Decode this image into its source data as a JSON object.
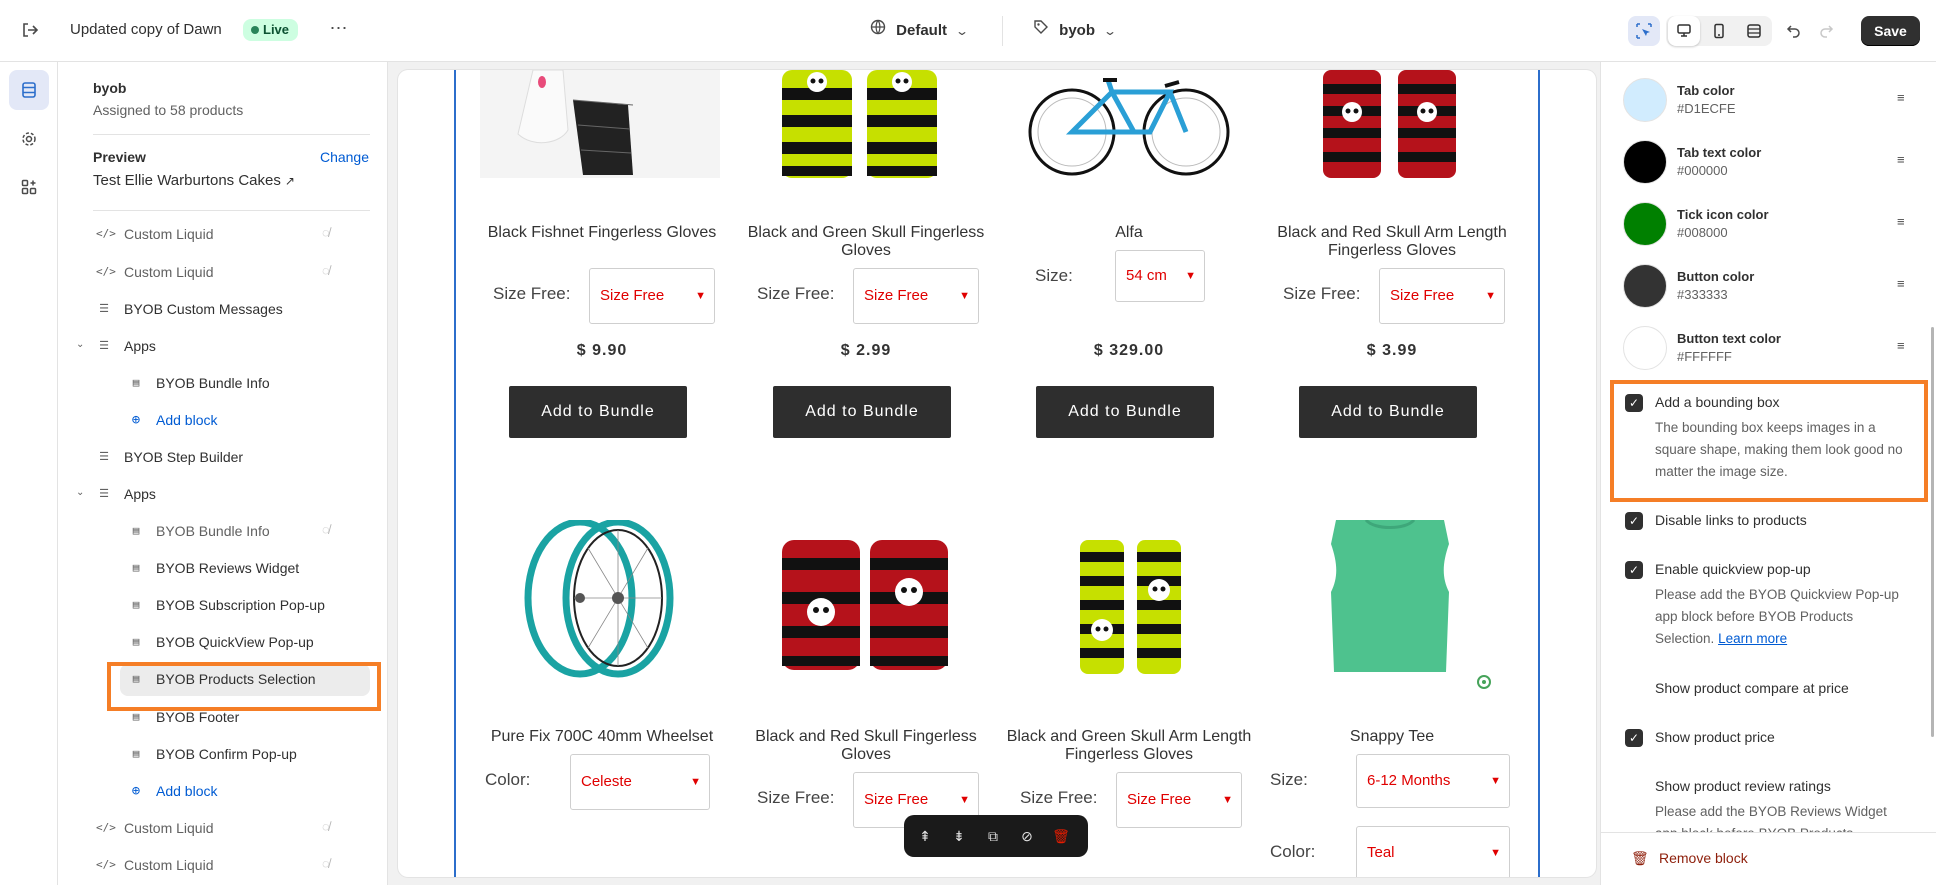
{
  "topbar": {
    "title": "Updated copy of Dawn",
    "status": "Live",
    "more": "⋯",
    "template_select": "Default",
    "page_select": "byob",
    "save_label": "Save"
  },
  "sidebar": {
    "heading": "byob",
    "subheading": "Assigned to 58 products",
    "preview_label": "Preview",
    "change_label": "Change",
    "preview_value": "Test Ellie Warburtons Cakes",
    "items": [
      {
        "label": "Custom Liquid"
      },
      {
        "label": "Custom Liquid"
      },
      {
        "label": "BYOB Custom Messages"
      },
      {
        "label": "Apps"
      },
      {
        "label": "BYOB Bundle Info"
      },
      {
        "label": "Add block"
      },
      {
        "label": "BYOB Step Builder"
      },
      {
        "label": "Apps"
      },
      {
        "label": "BYOB Bundle Info"
      },
      {
        "label": "BYOB Reviews Widget"
      },
      {
        "label": "BYOB Subscription Pop-up"
      },
      {
        "label": "BYOB QuickView Pop-up"
      },
      {
        "label": "BYOB Products Selection"
      },
      {
        "label": "BYOB Footer"
      },
      {
        "label": "BYOB Confirm Pop-up"
      },
      {
        "label": "Add block"
      },
      {
        "label": "Custom Liquid"
      },
      {
        "label": "Custom Liquid"
      }
    ]
  },
  "products": [
    {
      "name": "Black Fishnet Fingerless Gloves",
      "option_label": "Size Free:",
      "option_value": "Size Free",
      "price": "$ 9.90",
      "button": "Add to Bundle"
    },
    {
      "name": "Black and Green Skull Fingerless Gloves",
      "option_label": "Size Free:",
      "option_value": "Size Free",
      "price": "$ 2.99",
      "button": "Add to Bundle"
    },
    {
      "name": "Alfa",
      "option_label": "Size:",
      "option_value": "54 cm",
      "price": "$ 329.00",
      "button": "Add to Bundle"
    },
    {
      "name": "Black and Red Skull Arm Length Fingerless Gloves",
      "option_label": "Size Free:",
      "option_value": "Size Free",
      "price": "$ 3.99",
      "button": "Add to Bundle"
    },
    {
      "name": "Pure Fix 700C 40mm Wheelset",
      "option_label": "Color:",
      "option_value": "Celeste"
    },
    {
      "name": "Black and Red Skull Fingerless Gloves",
      "option_label": "Size Free:",
      "option_value": "Size Free"
    },
    {
      "name": "Black and Green Skull Arm Length Fingerless Gloves",
      "option_label": "Size Free:",
      "option_value": "Size Free"
    },
    {
      "name": "Snappy Tee",
      "option_label": "Size:",
      "option_value": "6-12 Months",
      "option2_label": "Color:",
      "option2_value": "Teal"
    }
  ],
  "settings": {
    "colors": [
      {
        "name": "Tab color",
        "value": "#D1ECFE",
        "hex": "#D1ECFE"
      },
      {
        "name": "Tab text color",
        "value": "#000000",
        "hex": "#000000"
      },
      {
        "name": "Tick icon color",
        "value": "#008000",
        "hex": "#008000"
      },
      {
        "name": "Button color",
        "value": "#333333",
        "hex": "#333333"
      },
      {
        "name": "Button text color",
        "value": "#FFFFFF",
        "hex": "#FFFFFF"
      }
    ],
    "bounding_box": {
      "label": "Add a bounding box",
      "desc": "The bounding box keeps images in a square shape, making them look good no matter the image size.",
      "checked": true
    },
    "disable_links": {
      "label": "Disable links to products",
      "checked": true
    },
    "quickview": {
      "label": "Enable quickview pop-up",
      "desc": "Please add the BYOB Quickview Pop-up app block before BYOB Products Selection.",
      "link": "Learn more",
      "checked": true
    },
    "compare_price": {
      "label": "Show product compare at price",
      "checked": false
    },
    "product_price": {
      "label": "Show product price",
      "checked": true
    },
    "review_ratings": {
      "label": "Show product review ratings",
      "desc": "Please add the BYOB Reviews Widget app block before BYOB Products",
      "checked": false
    },
    "remove_block": "Remove block"
  }
}
